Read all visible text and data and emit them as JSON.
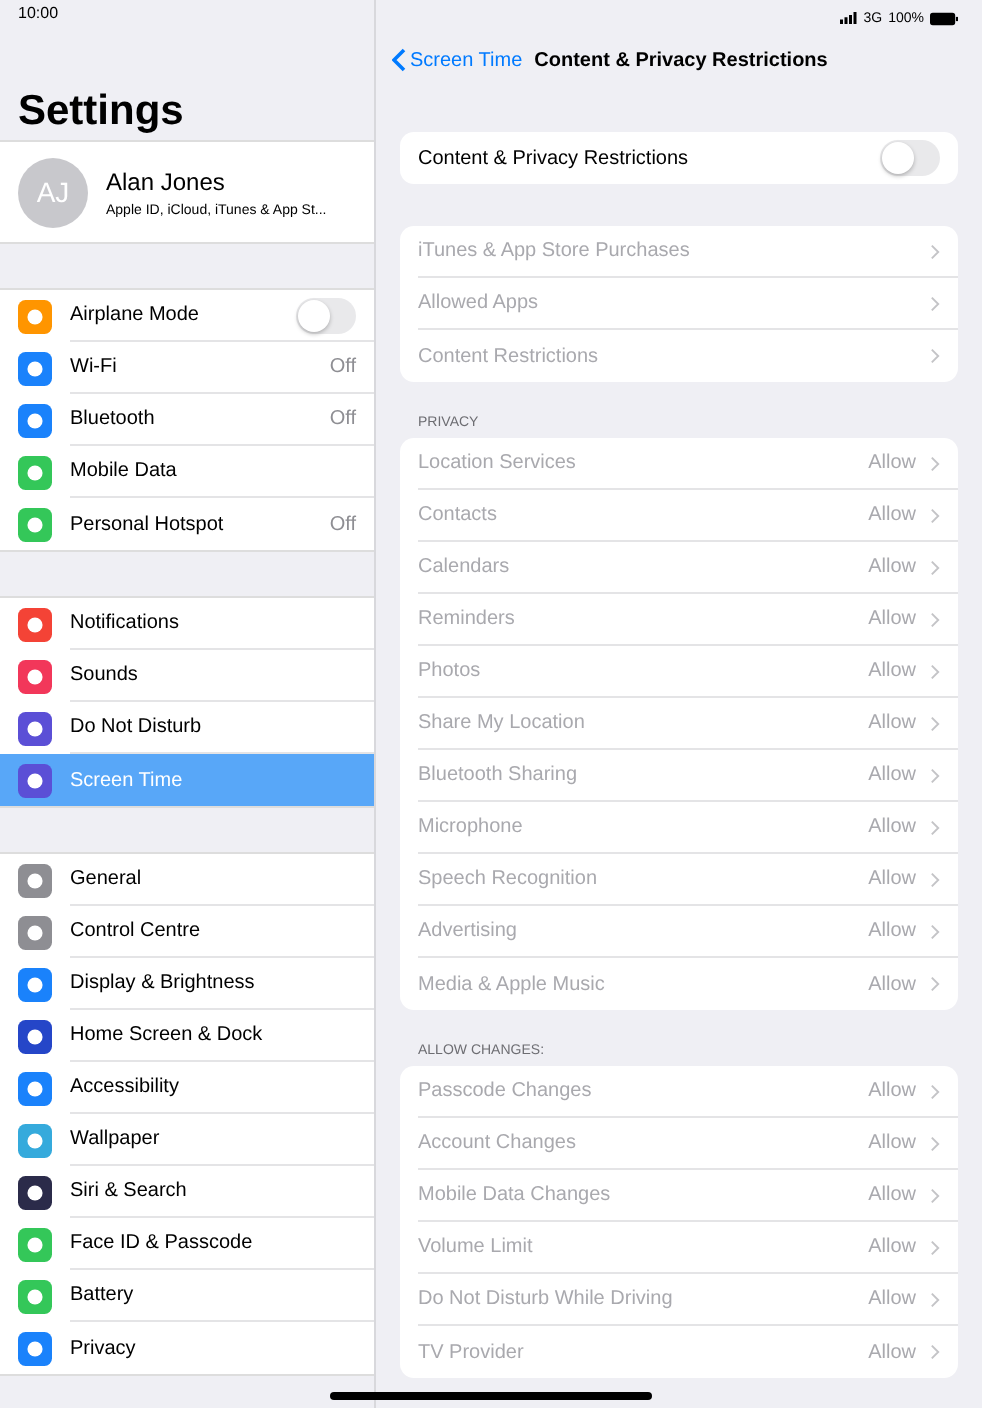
{
  "status_bar": {
    "time": "10:00",
    "network": "3G",
    "battery": "100%"
  },
  "sidebar": {
    "title": "Settings",
    "profile": {
      "initials": "AJ",
      "name": "Alan Jones",
      "subtitle": "Apple ID, iCloud, iTunes & App St..."
    },
    "groups": [
      [
        {
          "label": "Airplane Mode",
          "kind": "toggle",
          "on": false,
          "color": "#ff9500",
          "selected": false
        },
        {
          "label": "Wi-Fi",
          "kind": "value",
          "value": "Off",
          "color": "#1a82fb",
          "selected": false
        },
        {
          "label": "Bluetooth",
          "kind": "value",
          "value": "Off",
          "color": "#1a82fb",
          "selected": false
        },
        {
          "label": "Mobile Data",
          "kind": "plain",
          "color": "#34c759",
          "selected": false
        },
        {
          "label": "Personal Hotspot",
          "kind": "value",
          "value": "Off",
          "color": "#34c759",
          "selected": false
        }
      ],
      [
        {
          "label": "Notifications",
          "kind": "plain",
          "color": "#f44336",
          "selected": false
        },
        {
          "label": "Sounds",
          "kind": "plain",
          "color": "#f2375a",
          "selected": false
        },
        {
          "label": "Do Not Disturb",
          "kind": "plain",
          "color": "#5b4fd6",
          "selected": false
        },
        {
          "label": "Screen Time",
          "kind": "plain",
          "color": "#5b4fd6",
          "selected": true
        }
      ],
      [
        {
          "label": "General",
          "kind": "plain",
          "color": "#8e8e93",
          "selected": false
        },
        {
          "label": "Control Centre",
          "kind": "plain",
          "color": "#8e8e93",
          "selected": false
        },
        {
          "label": "Display & Brightness",
          "kind": "plain",
          "color": "#1a82fb",
          "selected": false
        },
        {
          "label": "Home Screen & Dock",
          "kind": "plain",
          "color": "#2546c8",
          "selected": false
        },
        {
          "label": "Accessibility",
          "kind": "plain",
          "color": "#1a82fb",
          "selected": false
        },
        {
          "label": "Wallpaper",
          "kind": "plain",
          "color": "#35aadc",
          "selected": false
        },
        {
          "label": "Siri & Search",
          "kind": "plain",
          "color": "#2b2b4a",
          "selected": false
        },
        {
          "label": "Face ID & Passcode",
          "kind": "plain",
          "color": "#34c759",
          "selected": false
        },
        {
          "label": "Battery",
          "kind": "plain",
          "color": "#34c759",
          "selected": false
        },
        {
          "label": "Privacy",
          "kind": "plain",
          "color": "#1a82fb",
          "selected": false
        }
      ]
    ]
  },
  "detail": {
    "back": "Screen Time",
    "title": "Content & Privacy Restrictions",
    "master": {
      "label": "Content & Privacy Restrictions",
      "on": false
    },
    "sections": [
      {
        "rows": [
          {
            "label": "iTunes & App Store Purchases",
            "disabled": true
          },
          {
            "label": "Allowed Apps",
            "disabled": true
          },
          {
            "label": "Content Restrictions",
            "disabled": true
          }
        ]
      },
      {
        "header": "PRIVACY",
        "rows": [
          {
            "label": "Location Services",
            "value": "Allow",
            "disabled": true
          },
          {
            "label": "Contacts",
            "value": "Allow",
            "disabled": true
          },
          {
            "label": "Calendars",
            "value": "Allow",
            "disabled": true
          },
          {
            "label": "Reminders",
            "value": "Allow",
            "disabled": true
          },
          {
            "label": "Photos",
            "value": "Allow",
            "disabled": true
          },
          {
            "label": "Share My Location",
            "value": "Allow",
            "disabled": true
          },
          {
            "label": "Bluetooth Sharing",
            "value": "Allow",
            "disabled": true
          },
          {
            "label": "Microphone",
            "value": "Allow",
            "disabled": true
          },
          {
            "label": "Speech Recognition",
            "value": "Allow",
            "disabled": true
          },
          {
            "label": "Advertising",
            "value": "Allow",
            "disabled": true
          },
          {
            "label": "Media & Apple Music",
            "value": "Allow",
            "disabled": true
          }
        ]
      },
      {
        "header": "ALLOW CHANGES:",
        "rows": [
          {
            "label": "Passcode Changes",
            "value": "Allow",
            "disabled": true
          },
          {
            "label": "Account Changes",
            "value": "Allow",
            "disabled": true
          },
          {
            "label": "Mobile Data Changes",
            "value": "Allow",
            "disabled": true
          },
          {
            "label": "Volume Limit",
            "value": "Allow",
            "disabled": true
          },
          {
            "label": "Do Not Disturb While Driving",
            "value": "Allow",
            "disabled": true
          },
          {
            "label": "TV Provider",
            "value": "Allow",
            "disabled": true
          }
        ]
      }
    ]
  }
}
